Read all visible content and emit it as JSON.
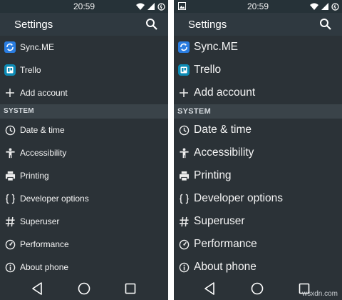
{
  "screens": [
    {
      "status_time": "20:59",
      "title": "Settings",
      "accounts": [
        {
          "label": "Sync.ME",
          "icon": "sync-me-app-icon"
        },
        {
          "label": "Trello",
          "icon": "trello-app-icon"
        },
        {
          "label": "Add account",
          "icon": "plus-icon"
        }
      ],
      "section_title": "SYSTEM",
      "system_items": [
        {
          "label": "Date & time",
          "icon": "clock-icon"
        },
        {
          "label": "Accessibility",
          "icon": "accessibility-icon"
        },
        {
          "label": "Printing",
          "icon": "printer-icon"
        },
        {
          "label": "Developer options",
          "icon": "braces-icon"
        },
        {
          "label": "Superuser",
          "icon": "hash-icon"
        },
        {
          "label": "Performance",
          "icon": "gauge-icon"
        },
        {
          "label": "About phone",
          "icon": "info-icon"
        }
      ]
    },
    {
      "status_time": "20:59",
      "title": "Settings",
      "accounts": [
        {
          "label": "Sync.ME",
          "icon": "sync-me-app-icon"
        },
        {
          "label": "Trello",
          "icon": "trello-app-icon"
        },
        {
          "label": "Add account",
          "icon": "plus-icon"
        }
      ],
      "section_title": "SYSTEM",
      "system_items": [
        {
          "label": "Date & time",
          "icon": "clock-icon"
        },
        {
          "label": "Accessibility",
          "icon": "accessibility-icon"
        },
        {
          "label": "Printing",
          "icon": "printer-icon"
        },
        {
          "label": "Developer options",
          "icon": "braces-icon"
        },
        {
          "label": "Superuser",
          "icon": "hash-icon"
        },
        {
          "label": "Performance",
          "icon": "gauge-icon"
        },
        {
          "label": "About phone",
          "icon": "info-icon"
        }
      ],
      "watermark": "wsxdn.com"
    }
  ],
  "colors": {
    "background": "#2b3237",
    "app_bar": "#2f3940",
    "status_bar": "#263238",
    "section_header": "#3a4349",
    "text": "#f4f4f4",
    "sync_me_blue": "#2a7de1",
    "trello_blue": "#0d8bb5"
  }
}
